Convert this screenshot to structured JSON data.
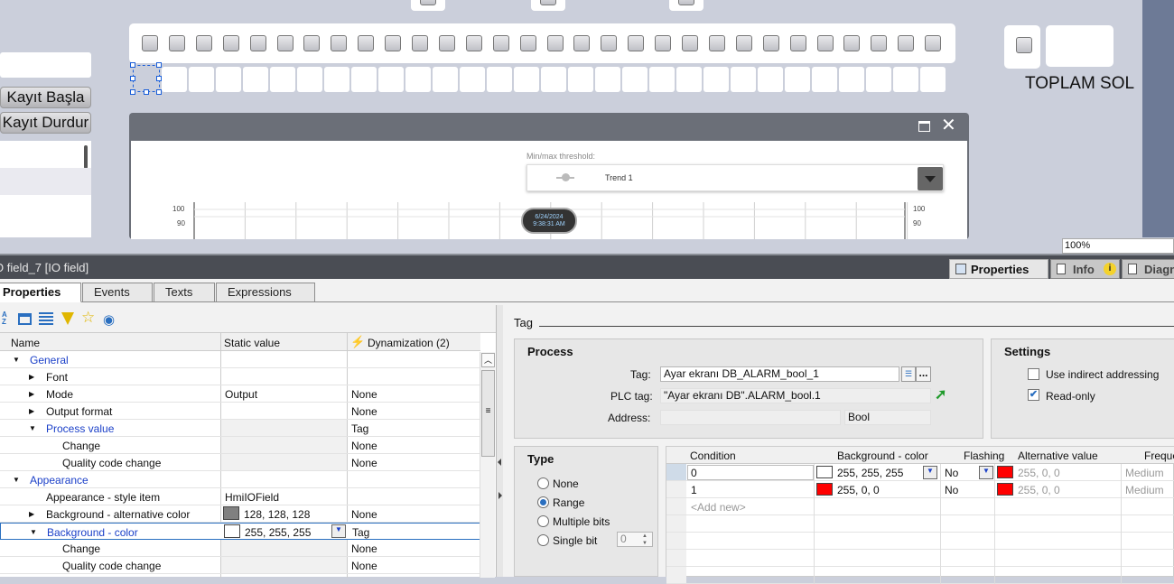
{
  "canvas": {
    "buttons": {
      "kayit_basla": "Kayıt Başla",
      "kayit_durdur": "Kayıt Durdur"
    },
    "toplam_label": "TOPLAM SOL",
    "zoom": "100%",
    "trend": {
      "threshold_label": "Min/max threshold:",
      "trend_name": "Trend 1",
      "timestamp_date": "6/24/2024",
      "timestamp_time": "9:38:31 AM",
      "y_ticks": [
        "100",
        "90"
      ]
    }
  },
  "inspector": {
    "title": "O field_7 [IO field]",
    "top_tabs": [
      {
        "label": "Properties"
      },
      {
        "label": "Info"
      },
      {
        "label": "Diagn"
      }
    ],
    "tabs": [
      "Properties",
      "Events",
      "Texts",
      "Expressions"
    ],
    "columns": {
      "name": "Name",
      "static": "Static value",
      "dyn": "Dynamization (2)"
    },
    "rows": [
      {
        "name": "General",
        "static": "",
        "dyn": ""
      },
      {
        "name": "Font",
        "static": "",
        "dyn": ""
      },
      {
        "name": "Mode",
        "static": "Output",
        "dyn": "None"
      },
      {
        "name": "Output format",
        "static": "",
        "dyn": "None"
      },
      {
        "name": "Process value",
        "static": "",
        "dyn": "Tag"
      },
      {
        "name": "Change",
        "static": "",
        "dyn": "None"
      },
      {
        "name": "Quality code change",
        "static": "",
        "dyn": "None"
      },
      {
        "name": "Appearance",
        "static": "",
        "dyn": ""
      },
      {
        "name": "Appearance - style item",
        "static": "HmiIOField",
        "dyn": ""
      },
      {
        "name": "Background - alternative color",
        "static": "128, 128, 128",
        "dyn": "None"
      },
      {
        "name": "Background - color",
        "static": "255, 255, 255",
        "dyn": "Tag"
      },
      {
        "name": "Change",
        "static": "",
        "dyn": "None"
      },
      {
        "name": "Quality code change",
        "static": "",
        "dyn": "None"
      }
    ],
    "tag_section": {
      "heading": "Tag",
      "process_title": "Process",
      "tag_label": "Tag:",
      "tag_value": "Ayar ekranı DB_ALARM_bool_1",
      "plc_label": "PLC tag:",
      "plc_value": "\"Ayar ekranı DB\".ALARM_bool.1",
      "address_label": "Address:",
      "address_type": "Bool",
      "settings_title": "Settings",
      "indirect_label": "Use indirect addressing",
      "readonly_label": "Read-only",
      "more_btn": "..."
    },
    "type_section": {
      "title": "Type",
      "options": [
        "None",
        "Range",
        "Multiple bits",
        "Single bit"
      ],
      "selected": "Range",
      "single_bit_value": "0"
    },
    "cond_table": {
      "headers": [
        "Condition",
        "Background - color",
        "Flashing",
        "Alternative value",
        "Frequency"
      ],
      "rows": [
        {
          "condition": "0",
          "bg": "255, 255, 255",
          "bg_color": "#ffffff",
          "flashing": "No",
          "alt": "255, 0, 0",
          "alt_color": "#ff0000",
          "freq": "Medium"
        },
        {
          "condition": "1",
          "bg": "255, 0, 0",
          "bg_color": "#ff0000",
          "flashing": "No",
          "alt": "255, 0, 0",
          "alt_color": "#ff0000",
          "freq": "Medium"
        }
      ],
      "add_new": "<Add new>"
    }
  }
}
